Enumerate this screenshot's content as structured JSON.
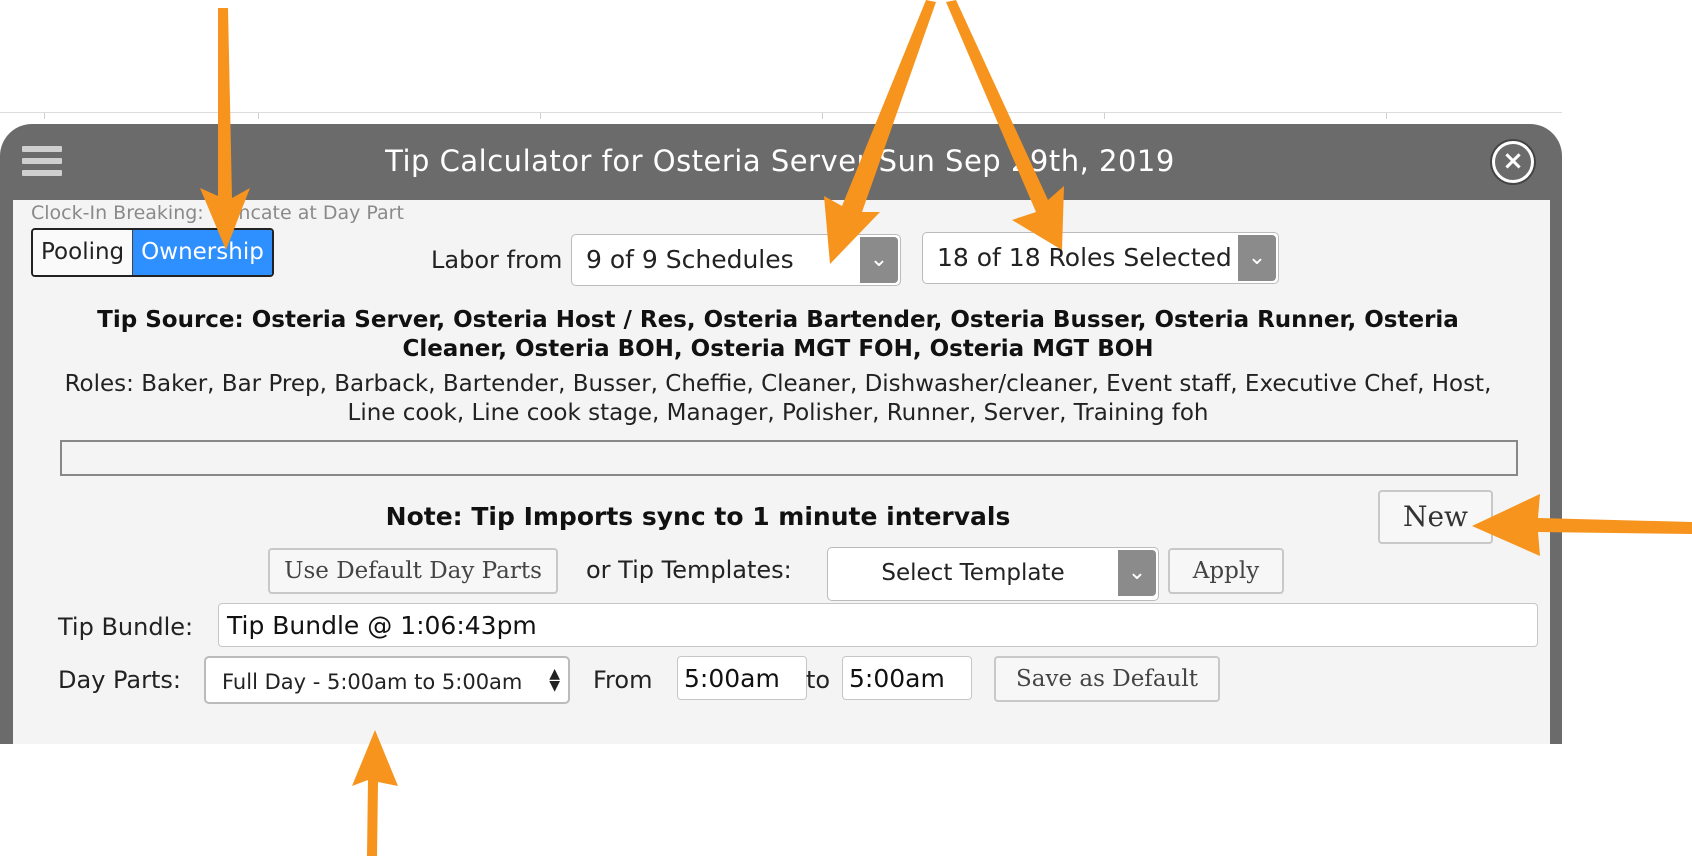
{
  "window": {
    "title": "Tip Calculator for Osteria Server Sun Sep 29th, 2019",
    "close_glyph": "×"
  },
  "toolbar": {
    "clock_in_breaking": "Clock-In Breaking: Truncate at Day Part",
    "mode_toggle": {
      "options": [
        "Pooling",
        "Ownership"
      ],
      "selected": "Ownership"
    },
    "labor_from_label": "Labor from",
    "schedules_dropdown": "9 of 9 Schedules",
    "roles_dropdown": "18 of 18 Roles Selected"
  },
  "info": {
    "tip_source": "Tip Source: Osteria Server, Osteria Host / Res, Osteria Bartender, Osteria Busser, Osteria Runner, Osteria Cleaner, Osteria BOH, Osteria MGT FOH, Osteria MGT BOH",
    "roles": "Roles: Baker, Bar Prep, Barback, Bartender, Busser, Cheffie, Cleaner, Dishwasher/cleaner, Event staff, Executive Chef, Host, Line cook, Line cook stage, Manager, Polisher, Runner, Server, Training foh",
    "progress_fraction": 0
  },
  "note": "Note: Tip Imports sync to 1 minute intervals",
  "buttons": {
    "new": "New",
    "use_default_day_parts": "Use Default Day Parts",
    "apply": "Apply",
    "save_as_default": "Save as Default"
  },
  "templates": {
    "label": "or Tip Templates:",
    "selected": "Select Template"
  },
  "bundle": {
    "label": "Tip Bundle:",
    "value": "Tip Bundle @ 1:06:43pm"
  },
  "day_parts": {
    "label": "Day Parts:",
    "selected": "Full Day - 5:00am to 5:00am",
    "from_label": "From",
    "from_value": "5:00am",
    "to_label": "to",
    "to_value": "5:00am"
  },
  "colors": {
    "accent": "#2e8fff",
    "titlebar": "#6b6b6b",
    "annotation_arrow": "#f7941d"
  }
}
